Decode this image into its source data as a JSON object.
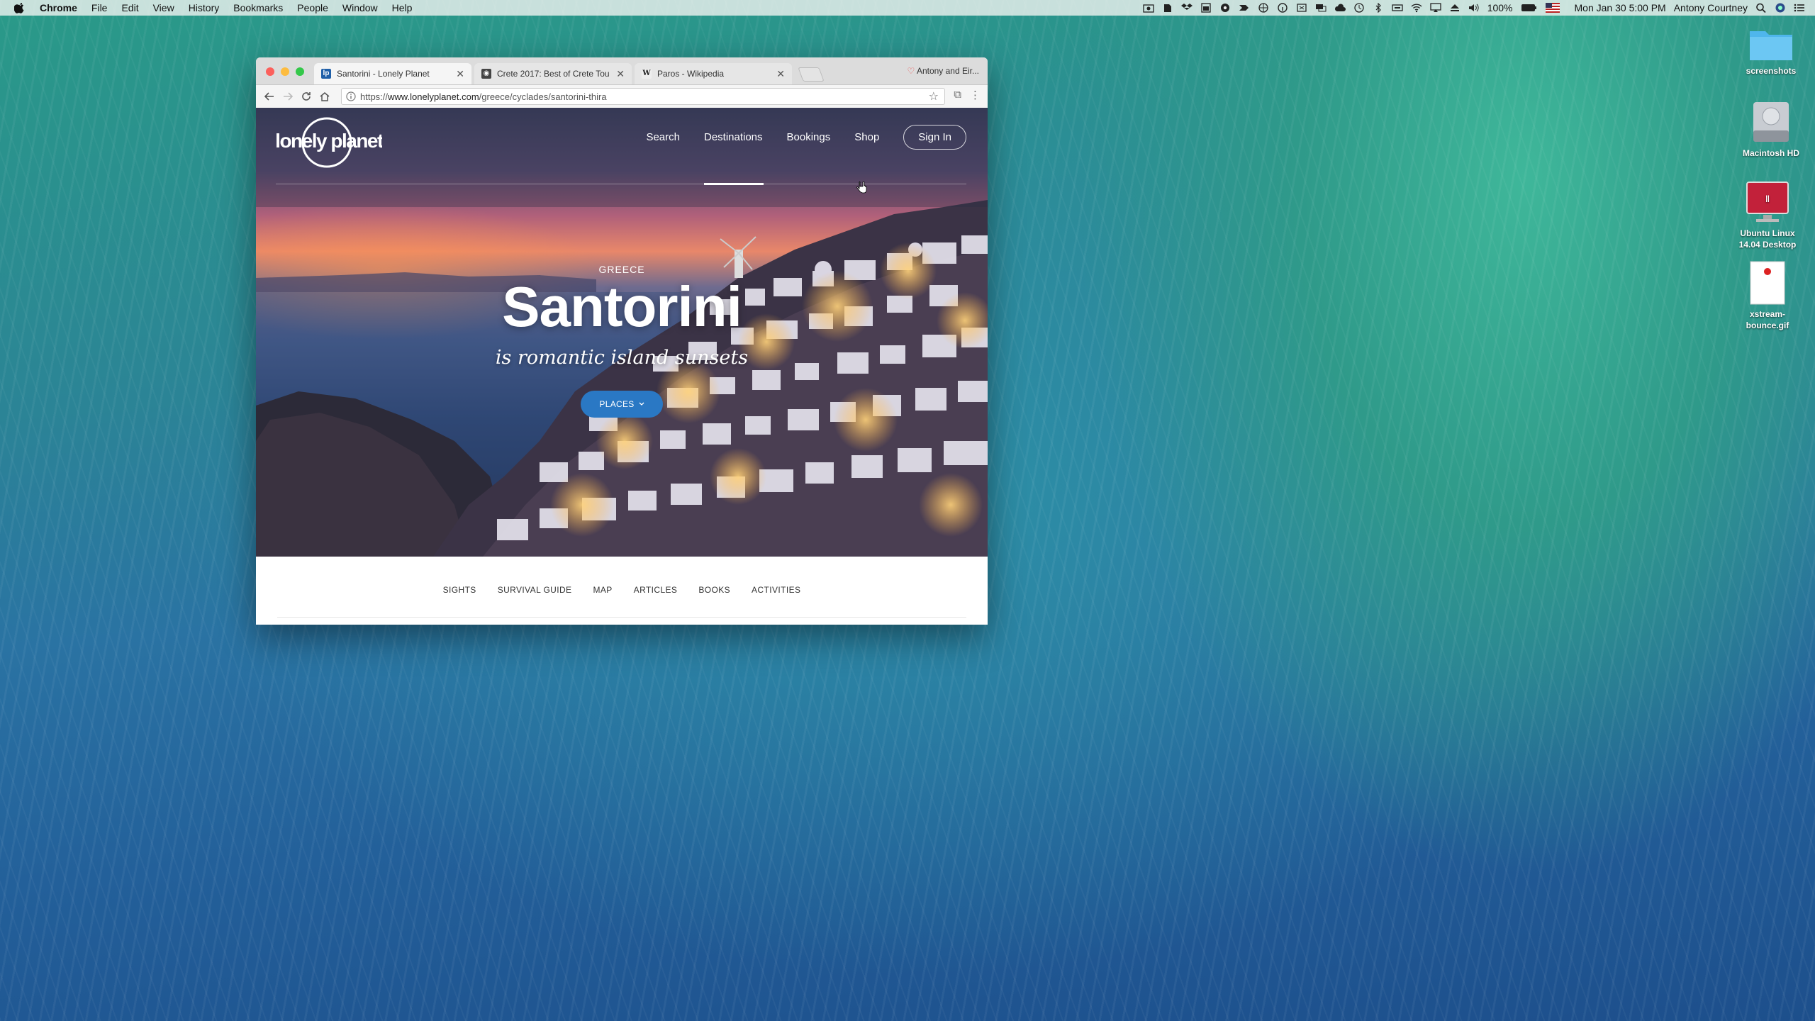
{
  "menubar": {
    "app": "Chrome",
    "items": [
      "File",
      "Edit",
      "View",
      "History",
      "Bookmarks",
      "People",
      "Window",
      "Help"
    ],
    "battery": "100%",
    "datetime": "Mon Jan 30  5:00 PM",
    "user": "Antony Courtney"
  },
  "desktop": {
    "icons": [
      {
        "label": "screenshots",
        "icon": "folder-icon"
      },
      {
        "label": "Macintosh HD",
        "icon": "hard-drive-icon"
      },
      {
        "label_line1": "Ubuntu Linux",
        "label_line2": "14.04 Desktop",
        "icon": "parallels-icon",
        "badge": "Parallels"
      },
      {
        "label_line1": "xstream-",
        "label_line2": "bounce.gif",
        "icon": "gif-file-icon"
      }
    ]
  },
  "browser": {
    "tabs": [
      {
        "title": "Santorini - Lonely Planet",
        "favicon": "lp"
      },
      {
        "title": "Crete 2017: Best of Crete Tou",
        "favicon": "tripadvisor"
      },
      {
        "title": "Paros - Wikipedia",
        "favicon": "W"
      }
    ],
    "profile": "Antony and Eir...",
    "url_prefix": "https://",
    "url_host": "www.lonelyplanet.com",
    "url_path": "/greece/cyclades/santorini-thira"
  },
  "page": {
    "logo": "lonely planet",
    "nav": [
      "Search",
      "Destinations",
      "Bookings",
      "Shop"
    ],
    "signin": "Sign In",
    "kicker": "GREECE",
    "title": "Santorini",
    "tagline": "is romantic island sunsets",
    "places_button": "PLACES",
    "subnav": [
      "SIGHTS",
      "SURVIVAL GUIDE",
      "MAP",
      "ARTICLES",
      "BOOKS",
      "ACTIVITIES"
    ]
  },
  "colors": {
    "accent_blue": "#2a78c4",
    "close": "#fc605c",
    "minimize": "#fdbc40",
    "zoom": "#34c84a"
  }
}
